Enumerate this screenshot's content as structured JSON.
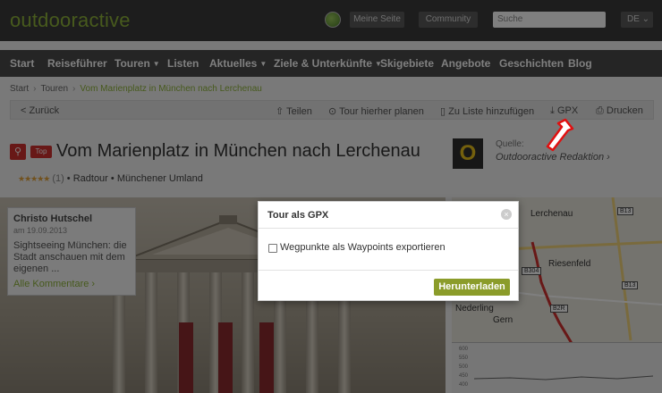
{
  "header": {
    "logo": "outdooractive",
    "my_page": "Meine Seite",
    "community": "Community",
    "search_placeholder": "Suche",
    "language": "DE ⌄"
  },
  "nav": {
    "items": [
      {
        "label": "Start",
        "dropdown": false
      },
      {
        "label": "Reiseführer",
        "dropdown": false
      },
      {
        "label": "Touren",
        "dropdown": true
      },
      {
        "label": "Listen",
        "dropdown": false
      },
      {
        "label": "Aktuelles",
        "dropdown": true
      },
      {
        "label": "Ziele & Unterkünfte",
        "dropdown": true
      },
      {
        "label": "Skigebiete",
        "dropdown": false
      },
      {
        "label": "Angebote",
        "dropdown": false
      },
      {
        "label": "Geschichten",
        "dropdown": false
      },
      {
        "label": "Blog",
        "dropdown": false
      }
    ]
  },
  "breadcrumb": {
    "items": [
      "Start",
      "Touren"
    ],
    "current": "Vom Marienplatz in München nach Lerchenau"
  },
  "actions": {
    "back": "< Zurück",
    "share": "Teilen",
    "plan": "Tour hierher planen",
    "add_list": "Zu Liste hinzufügen",
    "gpx": "GPX",
    "print": "Drucken"
  },
  "tour": {
    "badge": "Top",
    "title": "Vom Marienplatz in München nach Lerchenau",
    "rating_stars": "★★★★★",
    "rating_count": "(1)",
    "type": "• Radtour",
    "region": "• Münchener Umland",
    "source_label": "Quelle:",
    "source_name": "Outdooractive Redaktion ›",
    "source_logo": "O"
  },
  "comment": {
    "author": "Christo Hutschel",
    "date": "am 19.09.2013",
    "text": "Sightseeing München: die Stadt anschauen mit dem eigenen ...",
    "more": "Alle Kommentare ›"
  },
  "map": {
    "labels": [
      "Lerchenau",
      "Riesenfeld",
      "Nederling",
      "Gern"
    ],
    "roads": [
      "B13",
      "B13",
      "B304",
      "B2R"
    ],
    "profile_ticks": [
      "600",
      "550",
      "500",
      "450",
      "400"
    ]
  },
  "modal": {
    "title": "Tour als GPX",
    "close": "×",
    "checkbox_label": "Wegpunkte als Waypoints exportieren",
    "checkbox_checked": false,
    "download": "Herunterladen"
  },
  "colors": {
    "brand_green": "#8fb43a",
    "download_button": "#8b9c2a",
    "accent_red": "#d0302f"
  },
  "icons": {
    "share": "share-icon",
    "plan": "target-icon",
    "add_list": "phone-icon",
    "gpx": "download-icon",
    "print": "printer-icon",
    "close": "close-icon"
  }
}
